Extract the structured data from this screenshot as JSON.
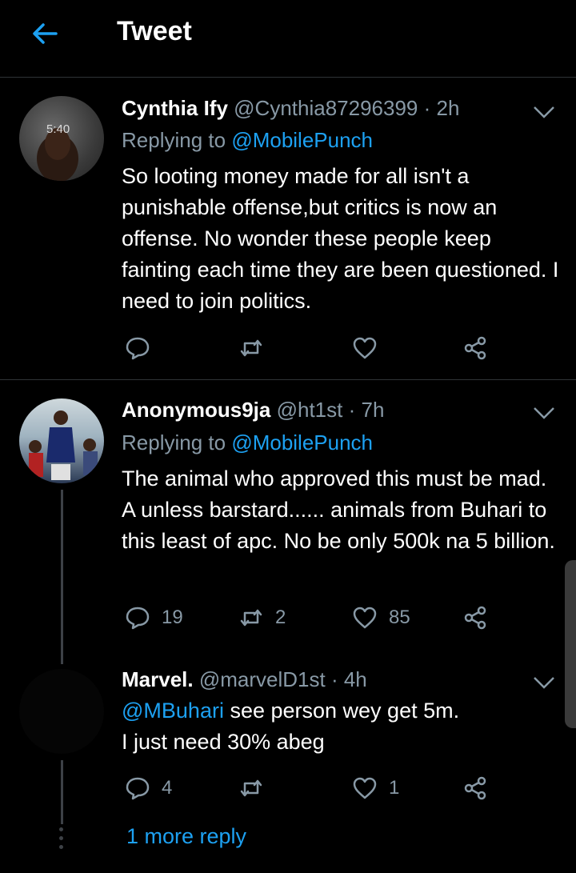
{
  "header": {
    "title": "Tweet"
  },
  "tweets": [
    {
      "name": "Cynthia Ify",
      "handle": "@Cynthia87296399",
      "time": "· 2h",
      "replying_prefix": "Replying to",
      "replying_to": "@MobilePunch",
      "text": "So looting money made for all  isn't a punishable offense,but critics is now an offense. No wonder these people keep fainting each time they are been questioned. I need to join politics.",
      "counts": {
        "reply": "",
        "retweet": "",
        "like": ""
      },
      "avatar_overlay": "5:40"
    },
    {
      "name": "Anonymous9ja",
      "handle": "@ht1st",
      "time": "· 7h",
      "replying_prefix": "Replying to",
      "replying_to": "@MobilePunch",
      "text": "The animal who approved this must be mad. A unless barstard...... animals from Buhari to this least of apc. No be only 500k na 5 billion.",
      "counts": {
        "reply": "19",
        "retweet": "2",
        "like": "85"
      }
    },
    {
      "name": "Marvel.",
      "handle": "@marvelD1st",
      "time": "· 4h",
      "mention": "@MBuhari",
      "text_line1": " see person wey get 5m.",
      "text_line2": "I just need 30% abeg",
      "counts": {
        "reply": "4",
        "retweet": "",
        "like": "1"
      }
    }
  ],
  "more_replies": "1 more reply",
  "colors": {
    "background": "#000000",
    "accent": "#1da1f2",
    "muted": "#8899a6",
    "divider": "#2f3336"
  },
  "icons": [
    "back-arrow-icon",
    "chevron-down-icon",
    "reply-icon",
    "retweet-icon",
    "like-icon",
    "share-icon"
  ]
}
